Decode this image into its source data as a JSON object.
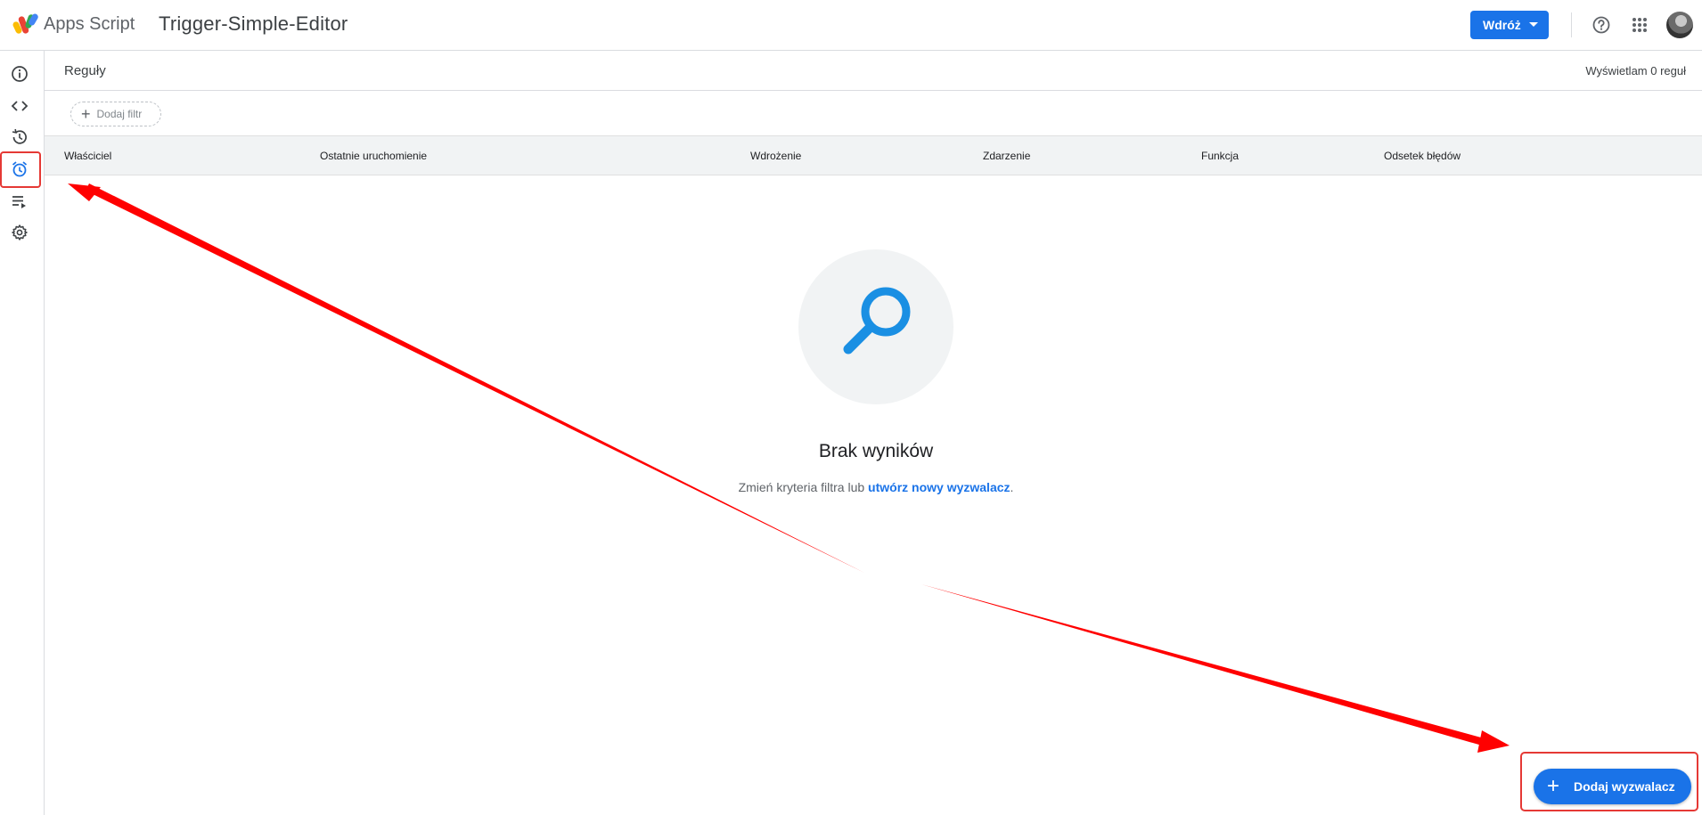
{
  "header": {
    "app_name": "Apps Script",
    "project_name": "Trigger-Simple-Editor",
    "deploy_label": "Wdróż"
  },
  "rail": {
    "items": [
      {
        "icon": "info-icon",
        "active": false
      },
      {
        "icon": "code-icon",
        "active": false
      },
      {
        "icon": "history-icon",
        "active": false
      },
      {
        "icon": "alarm-clock-icon",
        "active": true
      },
      {
        "icon": "executions-icon",
        "active": false
      },
      {
        "icon": "gear-icon",
        "active": false
      }
    ]
  },
  "main": {
    "title": "Reguły",
    "count_text": "Wyświetlam 0 reguł",
    "filter_label": "Dodaj filtr",
    "columns": [
      "Właściciel",
      "Ostatnie uruchomienie",
      "Wdrożenie",
      "Zdarzenie",
      "Funkcja",
      "Odsetek błędów"
    ],
    "empty_title": "Brak wyników",
    "empty_text": "Zmień kryteria filtra lub",
    "empty_link": "utwórz nowy wyzwalacz",
    "empty_end": "."
  },
  "fab": {
    "label": "Dodaj wyzwalacz"
  },
  "colors": {
    "accent": "#1a73e8",
    "annotation": "#e53935"
  }
}
